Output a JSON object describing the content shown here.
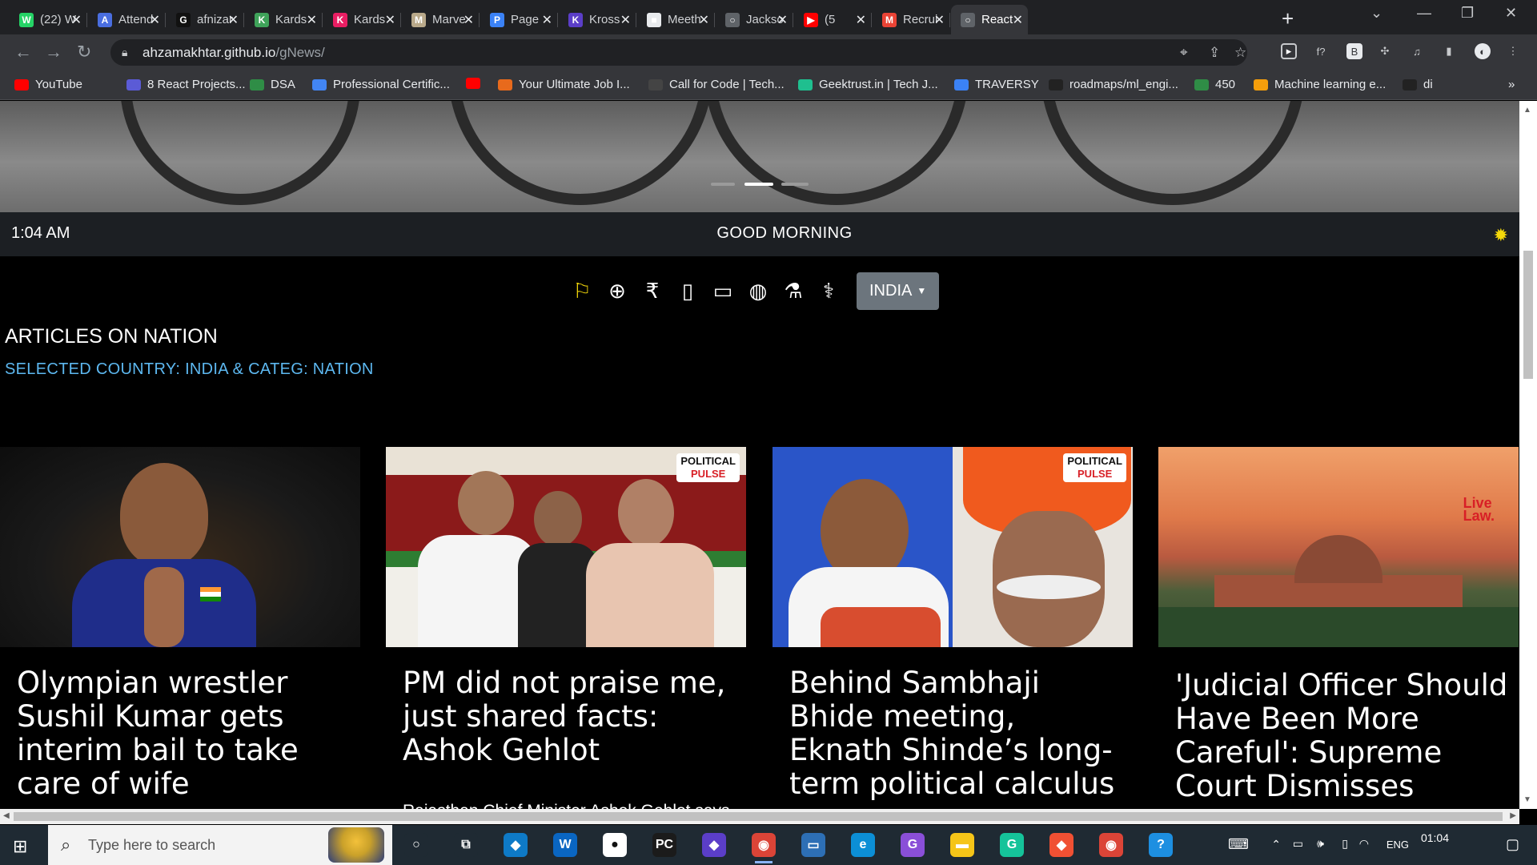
{
  "tabs": [
    {
      "title": "(22) W",
      "icon": "whatsapp-icon",
      "color": "#25d366",
      "glyph": "W"
    },
    {
      "title": "Attend",
      "icon": "attendance-icon",
      "color": "#4a6ee0",
      "glyph": "A"
    },
    {
      "title": "afnizar",
      "icon": "github-icon",
      "color": "#111111",
      "glyph": "G"
    },
    {
      "title": "Kards",
      "icon": "kards-leaf-icon",
      "color": "#3fa35a",
      "glyph": "K"
    },
    {
      "title": "Kards",
      "icon": "kards-k-icon",
      "color": "#e91e63",
      "glyph": "K"
    },
    {
      "title": "Marve",
      "icon": "marvel-icon",
      "color": "#b9a98a",
      "glyph": "M"
    },
    {
      "title": "Page",
      "icon": "page-icon",
      "color": "#3b82f6",
      "glyph": "P"
    },
    {
      "title": "Kross",
      "icon": "kross-icon",
      "color": "#5b3ec8",
      "glyph": "K"
    },
    {
      "title": "Meeth",
      "icon": "camera-icon",
      "color": "#e8eaed",
      "glyph": "■"
    },
    {
      "title": "Jackso",
      "icon": "globe-icon",
      "color": "#5f6368",
      "glyph": "○"
    },
    {
      "title": "(5",
      "icon": "youtube-icon",
      "color": "#ff0000",
      "glyph": "▶"
    },
    {
      "title": "Recrui",
      "icon": "gmail-icon",
      "color": "#ea4335",
      "glyph": "M"
    },
    {
      "title": "React",
      "icon": "globe-icon",
      "color": "#5f6368",
      "glyph": "○",
      "active": true
    }
  ],
  "toolbar": {
    "url_host": "ahzamakhtar.github.io",
    "url_path": "/gNews/"
  },
  "bookmarks": [
    {
      "label": "YouTube",
      "icon": "youtube-icon",
      "color": "#ff0000"
    },
    {
      "label": "8 React Projects...",
      "icon": "react-projects-icon",
      "color": "#5b5bd6"
    },
    {
      "label": "DSA",
      "icon": "gfg-icon",
      "color": "#2f8d46"
    },
    {
      "label": "Professional Certific...",
      "icon": "google-icon",
      "color": "#4285f4"
    },
    {
      "label": "",
      "icon": "youtube-icon",
      "color": "#ff0000"
    },
    {
      "label": "Your Ultimate Job I...",
      "icon": "job-icon",
      "color": "#e86a1c"
    },
    {
      "label": "Call for Code | Tech...",
      "icon": "callforcode-icon",
      "color": "#444444"
    },
    {
      "label": "Geektrust.in | Tech J...",
      "icon": "geektrust-icon",
      "color": "#1fbf8f"
    },
    {
      "label": "TRAVERSY",
      "icon": "traversy-icon",
      "color": "#3b82f6"
    },
    {
      "label": "roadmaps/ml_engi...",
      "icon": "github-icon",
      "color": "#222222"
    },
    {
      "label": "450",
      "icon": "gfg-icon",
      "color": "#2f8d46"
    },
    {
      "label": "Machine learning e...",
      "icon": "ml-icon",
      "color": "#f59e0b"
    },
    {
      "label": "di",
      "icon": "github-icon",
      "color": "#222222"
    }
  ],
  "app": {
    "time": "1:04 AM",
    "greeting": "GOOD MORNING",
    "country_button": "INDIA",
    "section_title": "ARTICLES ON NATION",
    "selection_text": "SELECTED COUNTRY: INDIA & CATEG: NATION",
    "categories": [
      {
        "name": "nation",
        "icon": "flag-icon",
        "glyph": "⚐",
        "active": true
      },
      {
        "name": "world",
        "icon": "globe-icon",
        "glyph": "⊕"
      },
      {
        "name": "business",
        "icon": "rupee-icon",
        "glyph": "₹"
      },
      {
        "name": "technology",
        "icon": "phone-icon",
        "glyph": "▯"
      },
      {
        "name": "entertainment",
        "icon": "monitor-icon",
        "glyph": "▭"
      },
      {
        "name": "sports",
        "icon": "baseball-icon",
        "glyph": "◍"
      },
      {
        "name": "science",
        "icon": "flask-icon",
        "glyph": "⚗"
      },
      {
        "name": "health",
        "icon": "doctor-icon",
        "glyph": "⚕"
      }
    ]
  },
  "articles": [
    {
      "headline": "Olympian wrestler Sushil Kumar gets interim bail to take care of wife",
      "description": "",
      "badge": ""
    },
    {
      "headline": "PM did not praise me, just shared facts: Ashok Gehlot",
      "description": "Rajasthan Chief Minister Ashok Gehlot says there's no internal challenge, every",
      "badge": "POLITICAL PULSE"
    },
    {
      "headline": "Behind Sambhaji Bhide meeting, Eknath Shinde’s long-term political calculus",
      "description": "",
      "badge": "POLITICAL PULSE"
    },
    {
      "headline": "'Judicial Officer Should Have Been More Careful': Supreme Court Dismisses",
      "description": "",
      "badge": "Live Law"
    }
  ],
  "taskbar": {
    "search_placeholder": "Type here to search",
    "time": "01:04",
    "lang": "ENG",
    "apps": [
      {
        "icon": "cortana-icon",
        "color": "#1f2a33",
        "glyph": "○"
      },
      {
        "icon": "taskview-icon",
        "color": "#1f2a33",
        "glyph": "⧉"
      },
      {
        "icon": "vscode-icon",
        "color": "#0e7ac7",
        "glyph": "◆"
      },
      {
        "icon": "app-w-icon",
        "color": "#0a66c2",
        "glyph": "W"
      },
      {
        "icon": "app-circle-icon",
        "color": "#ffffff",
        "glyph": "●"
      },
      {
        "icon": "pycharm-icon",
        "color": "#1b1b1b",
        "glyph": "PC"
      },
      {
        "icon": "app-diamond-icon",
        "color": "#5b3ec8",
        "glyph": "◆"
      },
      {
        "icon": "chrome-icon",
        "color": "#db4437",
        "glyph": "◉",
        "running": true
      },
      {
        "icon": "monitor-icon",
        "color": "#2d6fb5",
        "glyph": "▭"
      },
      {
        "icon": "edge-icon",
        "color": "#0c8fd6",
        "glyph": "e"
      },
      {
        "icon": "github-desktop-icon",
        "color": "#8a4fd8",
        "glyph": "G"
      },
      {
        "icon": "folder-icon",
        "color": "#f5c518",
        "glyph": "▬"
      },
      {
        "icon": "grammarly-icon",
        "color": "#15c39a",
        "glyph": "G"
      },
      {
        "icon": "git-icon",
        "color": "#f05033",
        "glyph": "◆"
      },
      {
        "icon": "chrome-icon",
        "color": "#db4437",
        "glyph": "◉"
      },
      {
        "icon": "help-icon",
        "color": "#1d8fe1",
        "glyph": "?"
      }
    ]
  }
}
